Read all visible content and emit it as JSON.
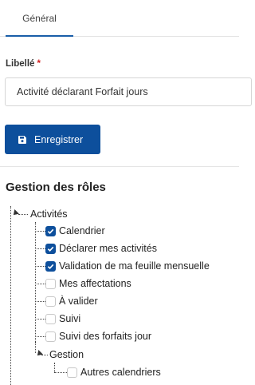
{
  "tabs": [
    {
      "label": "Général",
      "active": true
    }
  ],
  "form": {
    "label_title": "Libellé",
    "required_mark": "*",
    "label_value": "Activité déclarant Forfait jours",
    "save_label": "Enregistrer",
    "save_icon": "floppy-disk-icon"
  },
  "roles": {
    "title": "Gestion des rôles",
    "tree": [
      {
        "label": "Activités",
        "expanded": true,
        "children": [
          {
            "label": "Calendrier",
            "checked": true
          },
          {
            "label": "Déclarer mes activités",
            "checked": true
          },
          {
            "label": "Validation de ma feuille mensuelle",
            "checked": true
          },
          {
            "label": "Mes affectations",
            "checked": false
          },
          {
            "label": "À valider",
            "checked": false
          },
          {
            "label": "Suivi",
            "checked": false
          },
          {
            "label": "Suivi des forfaits jour",
            "checked": false
          }
        ]
      },
      {
        "label": "Gestion",
        "expanded": true,
        "children": [
          {
            "label": "Autres calendriers",
            "checked": false
          }
        ]
      }
    ]
  },
  "colors": {
    "primary": "#0d4f9c",
    "required": "#d21f1f"
  }
}
